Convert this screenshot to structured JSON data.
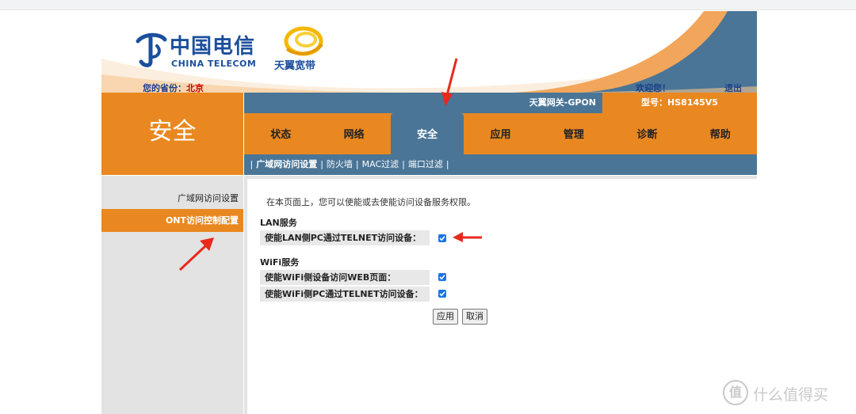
{
  "header": {
    "ct_cn": "中国电信",
    "ct_en": "CHINA TELECOM",
    "tianyi": "天翼宽带",
    "province_label": "您的省份：",
    "province_value": "北京",
    "welcome": "欢迎您！",
    "logout": "退出"
  },
  "section_title": "安全",
  "gateway": {
    "label": "天翼网关-GPON",
    "model": "型号：HS8145V5"
  },
  "tabs": [
    "状态",
    "网络",
    "安全",
    "应用",
    "管理",
    "诊断",
    "帮助"
  ],
  "active_tab": "安全",
  "subnav": [
    "广域网访问设置",
    "防火墙",
    "MAC过滤",
    "端口过滤"
  ],
  "left_menu": [
    "广域网访问设置",
    "ONT访问控制配置"
  ],
  "content": {
    "intro": "在本页面上，您可以使能或去使能访问设备服务权限。",
    "lan_title": "LAN服务",
    "lan_telnet": "使能LAN侧PC通过TELNET访问设备：",
    "wifi_title": "WiFi服务",
    "wifi_web": "使能WiFi侧设备访问WEB页面：",
    "wifi_telnet": "使能WiFi侧PC通过TELNET访问设备："
  },
  "buttons": {
    "apply": "应用",
    "cancel": "取消"
  },
  "watermark": {
    "icon": "值",
    "text": "什么值得买"
  },
  "colors": {
    "orange": "#e98820",
    "steel_blue": "#4a7597",
    "arrow_red": "#e8291c",
    "checkbox_blue": "#1a73e8"
  }
}
